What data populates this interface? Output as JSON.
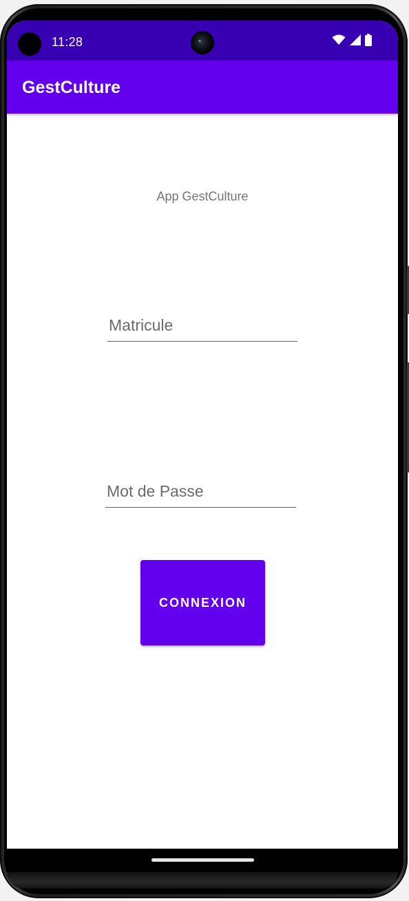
{
  "status_bar": {
    "time": "11:28",
    "icons": [
      "wifi-icon",
      "cellular-signal-icon",
      "battery-icon"
    ]
  },
  "app_bar": {
    "title": "GestCulture"
  },
  "main": {
    "subtitle": "App GestCulture",
    "matricule_placeholder": "Matricule",
    "password_placeholder": "Mot de Passe",
    "connect_label": "CONNEXION"
  },
  "colors": {
    "status_bar": "#3700b3",
    "primary": "#6200ee",
    "background": "#ffffff",
    "hint_text": "#6a6a6a"
  }
}
